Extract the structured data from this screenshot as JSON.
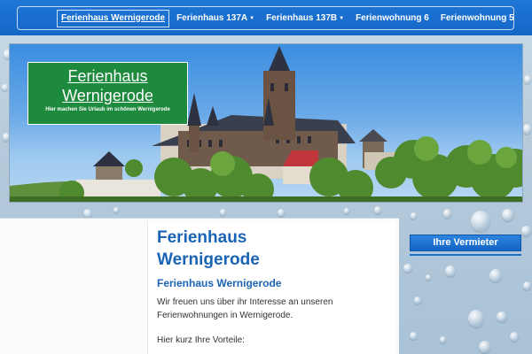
{
  "nav": {
    "items": [
      {
        "label": "Ferienhaus Wernigerode",
        "active": true,
        "dropdown": false
      },
      {
        "label": "Ferienhaus 137A",
        "active": false,
        "dropdown": true
      },
      {
        "label": "Ferienhaus 137B",
        "active": false,
        "dropdown": true
      },
      {
        "label": "Ferienwohnung 6",
        "active": false,
        "dropdown": false
      },
      {
        "label": "Ferienwohnung 5",
        "active": false,
        "dropdown": false
      }
    ]
  },
  "header": {
    "logo_title_line1": "Ferienhaus",
    "logo_title_line2": "Wernigerode",
    "logo_tagline": "Hier machen Sie Urlaub im schönen Wernigerode",
    "image_icon": "castle-photo"
  },
  "main": {
    "heading_line1": "Ferienhaus",
    "heading_line2": "Wernigerode",
    "subheading": "Ferienhaus Wernigerode",
    "paragraph": "Wir freuen uns über ihr Interesse an unseren Ferienwohnungen in Wernigerode.",
    "advantages_intro": "Hier kurz Ihre Vorteile:"
  },
  "sidebar": {
    "button_label": "Ihre Vermieter"
  },
  "colors": {
    "brand_blue": "#1567c6",
    "logo_green": "#1e8a3e",
    "heading_blue": "#1b64b5"
  }
}
